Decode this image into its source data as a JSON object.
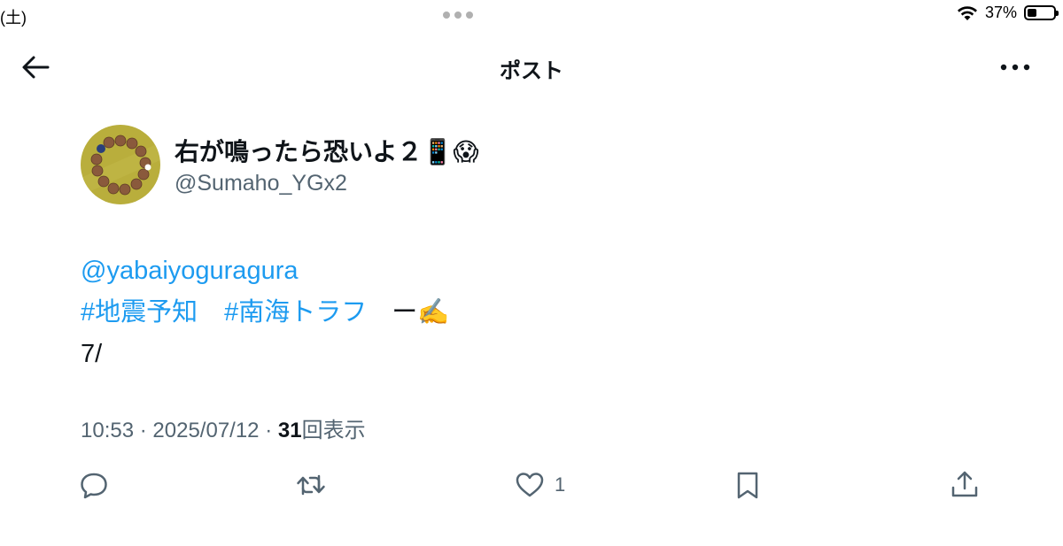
{
  "status_bar": {
    "date": "(土)",
    "battery_percent": "37%",
    "battery_level": 0.37
  },
  "header": {
    "title": "ポスト"
  },
  "author": {
    "name": "右が鳴ったら恐いよ２",
    "name_emoji": "📱😱",
    "handle": "@Sumaho_YGx2"
  },
  "tweet": {
    "mention": "@yabaiyoguragura",
    "hashtags": [
      "#地震予知",
      "#南海トラフ"
    ],
    "trailing": "ー✍️",
    "line3": "7/"
  },
  "meta": {
    "time": "10:53",
    "separator": "·",
    "date": "2025/07/12",
    "views_count": "31",
    "views_label": "回表示"
  },
  "actions": {
    "reply_icon": "reply-icon",
    "retweet_icon": "retweet-icon",
    "like_icon": "heart-icon",
    "like_count": "1",
    "bookmark_icon": "bookmark-icon",
    "share_icon": "share-icon"
  },
  "colors": {
    "link": "#1d9bf0",
    "secondary": "#536471",
    "text": "#0f1419"
  }
}
